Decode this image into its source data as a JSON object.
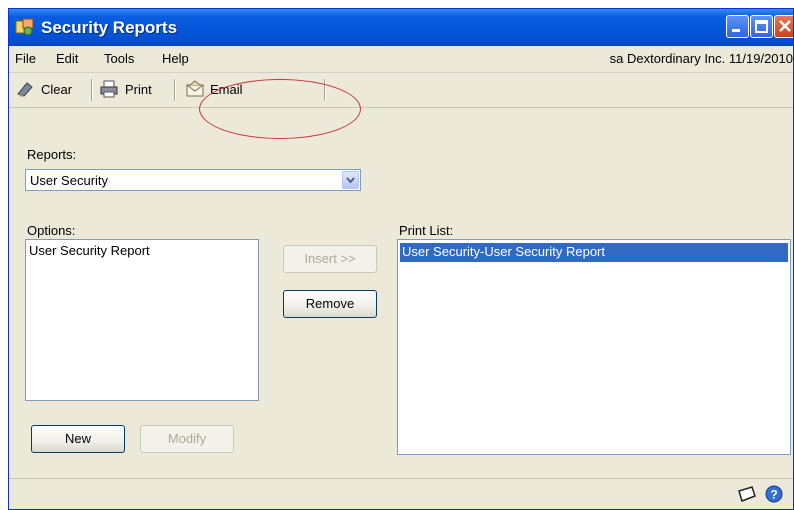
{
  "window": {
    "title": "Security Reports",
    "accent": "#0554D8"
  },
  "menu": {
    "items": [
      {
        "label": "File"
      },
      {
        "label": "Edit"
      },
      {
        "label": "Tools"
      },
      {
        "label": "Help"
      }
    ],
    "user_info": "sa  Dextordinary Inc.  11/19/2010"
  },
  "toolbar": {
    "clear_label": "Clear",
    "print_label": "Print",
    "email_label": "Email",
    "clear_icon": "eraser-icon",
    "print_icon": "printer-icon",
    "email_icon": "email-icon",
    "highlight_color": "#c8383a"
  },
  "reports": {
    "label": "Reports:",
    "selected": "User Security"
  },
  "options": {
    "label": "Options:",
    "items": [
      "User Security Report"
    ]
  },
  "print_list": {
    "label": "Print List:",
    "items": [
      "User Security-User Security Report"
    ],
    "selection_color": "#316AC5"
  },
  "buttons": {
    "insert": "Insert >>",
    "remove": "Remove",
    "new": "New",
    "modify": "Modify"
  },
  "status": {
    "note_icon": "note-icon",
    "help_icon": "help-icon"
  }
}
